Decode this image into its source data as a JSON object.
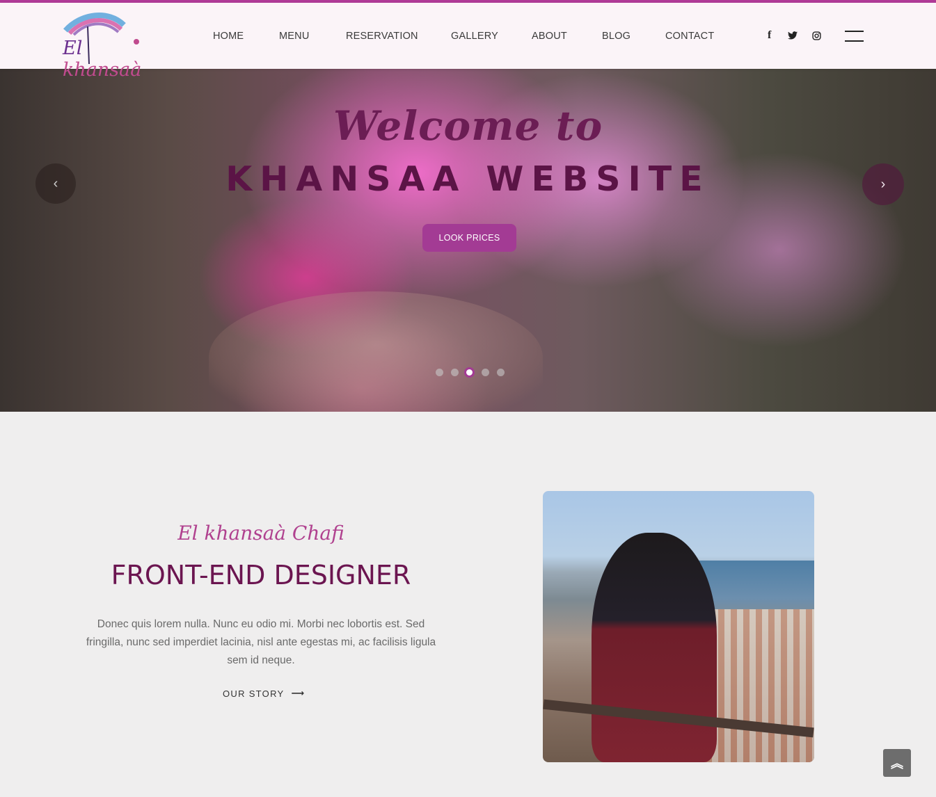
{
  "colors": {
    "accent": "#b03a97",
    "button": "#a33b94",
    "title": "#6b1550",
    "header_bg": "#fbf4f8",
    "page_bg": "#efeeee"
  },
  "header": {
    "logo_text_part1": "El ",
    "logo_text_part2": "khansaà",
    "nav": [
      {
        "label": "HOME"
      },
      {
        "label": "MENU"
      },
      {
        "label": "RESERVATION"
      },
      {
        "label": "GALLERY"
      },
      {
        "label": "ABOUT"
      },
      {
        "label": "BLOG"
      },
      {
        "label": "CONTACT"
      }
    ],
    "social": [
      {
        "icon": "facebook-icon",
        "glyph": "f"
      },
      {
        "icon": "twitter-icon",
        "glyph": "🐦"
      },
      {
        "icon": "instagram-icon",
        "glyph": "◎"
      }
    ],
    "menu_icon": "hamburger-icon"
  },
  "hero": {
    "welcome": "Welcome to",
    "title": "KHANSAA WEBSITE",
    "button_label": "LOOK PRICES",
    "prev_glyph": "‹",
    "next_glyph": "›",
    "slides_total": 5,
    "active_slide": 3
  },
  "about": {
    "name": "El khansaà Chafi",
    "role": "FRONT-END DESIGNER",
    "text": "Donec quis lorem nulla. Nunc eu odio mi. Morbi nec lobortis est. Sed fringilla, nunc sed imperdiet lacinia, nisl ante egestas mi, ac facilisis ligula sem id neque.",
    "link_label": "OUR STORY",
    "link_arrow": "⟶"
  },
  "scroll_top_glyph": "︽"
}
